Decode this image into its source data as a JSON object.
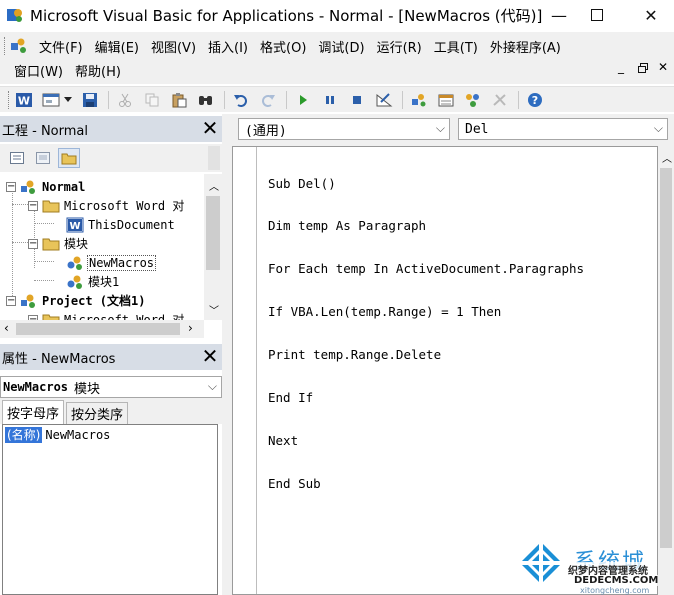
{
  "window": {
    "title": "Microsoft Visual Basic for Applications - Normal - [NewMacros (代码)]",
    "minimize_glyph": "—",
    "maximize_glyph": "☐",
    "close_glyph": "✕"
  },
  "menubar": {
    "row1": [
      "文件(F)",
      "编辑(E)",
      "视图(V)",
      "插入(I)",
      "格式(O)",
      "调试(D)",
      "运行(R)",
      "工具(T)",
      "外接程序(A)"
    ],
    "row2": [
      "窗口(W)",
      "帮助(H)"
    ],
    "mdi_controls": [
      "_",
      "🗗",
      "✕"
    ]
  },
  "toolbar": {
    "icons": [
      "word-icon",
      "insert-userform-icon",
      "dropdown-arrow-icon",
      "save-icon",
      "cut-icon",
      "copy-icon",
      "paste-icon",
      "find-icon",
      "undo-icon",
      "redo-icon",
      "run-icon",
      "break-icon",
      "reset-icon",
      "design-mode-icon",
      "project-explorer-icon",
      "properties-window-icon",
      "object-browser-icon",
      "toolbox-icon",
      "help-icon"
    ]
  },
  "project_panel": {
    "title": "工程 - Normal",
    "tree": [
      {
        "label": "Normal",
        "bold": true
      },
      {
        "label": "Microsoft Word 对"
      },
      {
        "label": "ThisDocument"
      },
      {
        "label": "模块"
      },
      {
        "label": "NewMacros"
      },
      {
        "label": "模块1"
      },
      {
        "label": "Project (文档1)",
        "bold": true
      },
      {
        "label": "Microsoft Word 对"
      }
    ]
  },
  "properties_panel": {
    "title": "属性 - NewMacros",
    "object_name": "NewMacros",
    "object_type": "模块",
    "tabs": [
      "按字母序",
      "按分类序"
    ],
    "rows": [
      {
        "name": "(名称)",
        "value": "NewMacros"
      }
    ]
  },
  "code_window": {
    "object_dropdown": "(通用)",
    "procedure_dropdown": "Del",
    "lines": [
      "Sub Del()",
      "Dim temp As Paragraph",
      "For Each temp In ActiveDocument.Paragraphs",
      "If VBA.Len(temp.Range) = 1 Then",
      "Print temp.Range.Delete",
      "End If",
      "Next",
      "End Sub"
    ]
  },
  "watermark": {
    "text1": "系统城",
    "text2": "xitongcheng.com",
    "text3": "织梦内容管理系统",
    "text4": "DEDECMS.COM"
  },
  "colors": {
    "panel_header": "#d7dde6",
    "selection": "#3475d9",
    "chrome": "#f0f0f0"
  }
}
